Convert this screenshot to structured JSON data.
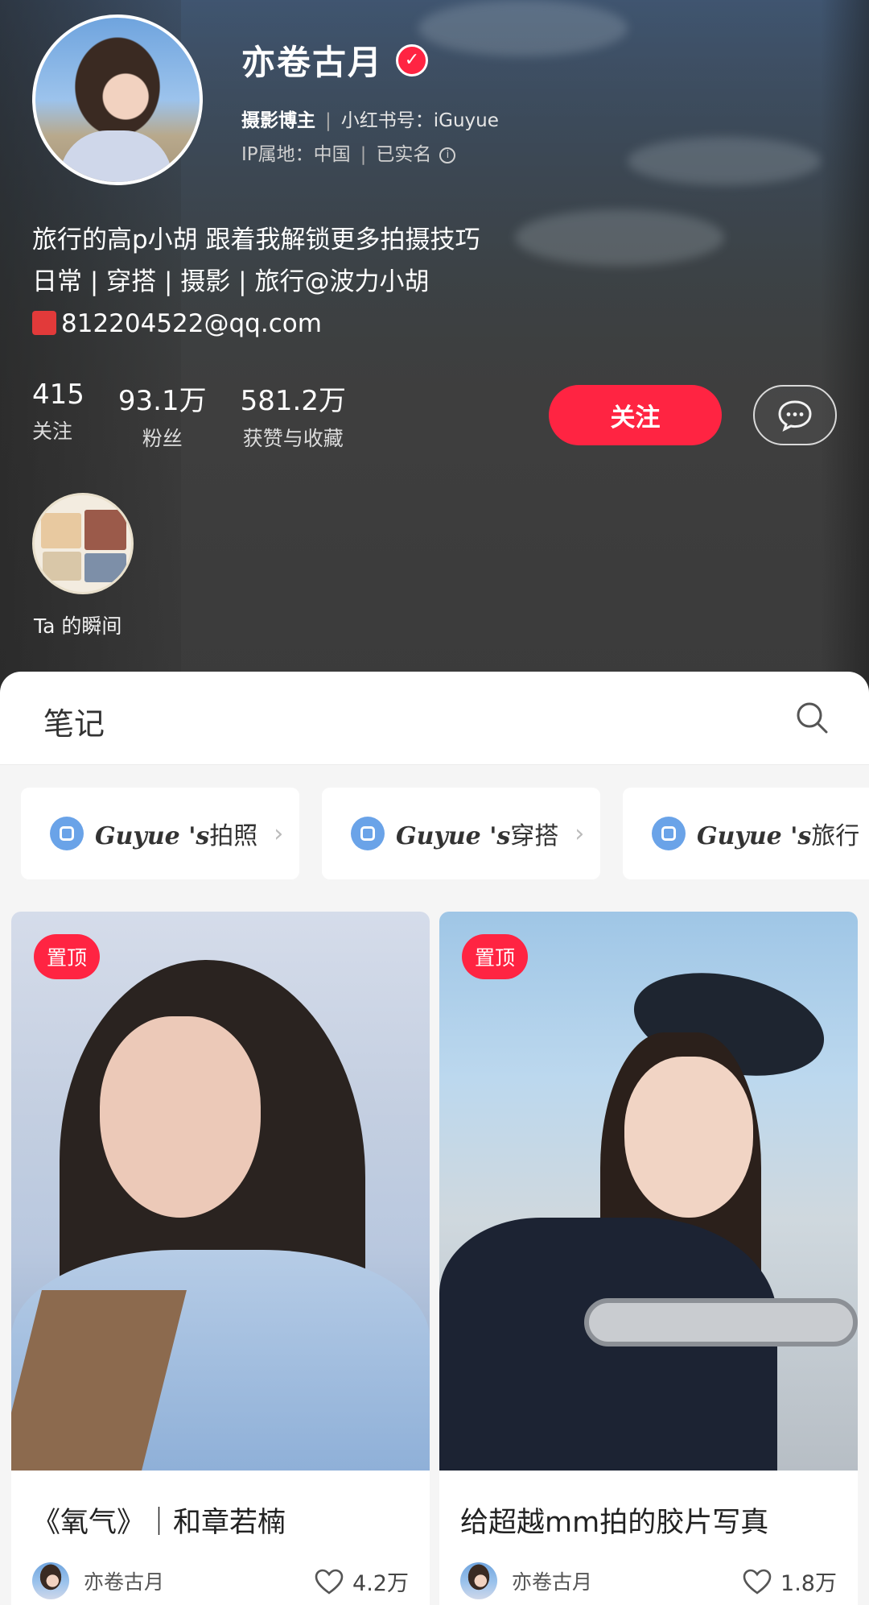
{
  "profile": {
    "name": "亦卷古月",
    "role": "摄影博主",
    "account_label": "小红书号：",
    "account_id": "iGuyue",
    "ip_label": "IP属地：",
    "ip_value": "中国",
    "realname": "已实名",
    "bio_line1": "旅行的高p小胡  跟着我解锁更多拍摄技巧",
    "bio_line2": "日常 | 穿搭 | 摄影 | 旅行@波力小胡",
    "bio_email": "812204522@qq.com",
    "follow_label": "关注",
    "moment_label": "Ta 的瞬间"
  },
  "stats": [
    {
      "value": "415",
      "label": "关注"
    },
    {
      "value": "93.1万",
      "label": "粉丝"
    },
    {
      "value": "581.2万",
      "label": "获赞与收藏"
    }
  ],
  "notes_tab": {
    "title": "笔记"
  },
  "collections": [
    {
      "prefix": "Guyue 's",
      "suffix": "拍照"
    },
    {
      "prefix": "Guyue 's",
      "suffix": "穿搭"
    },
    {
      "prefix": "Guyue 's",
      "suffix": "旅行"
    }
  ],
  "cards": [
    {
      "badge": "置顶",
      "title": "《氧气》｜和章若楠",
      "author": "亦卷古月",
      "likes": "4.2万"
    },
    {
      "badge": "置顶",
      "title": "给超越mm拍的胶片写真",
      "author": "亦卷古月",
      "likes": "1.8万"
    }
  ],
  "colors": {
    "accent": "#ff2442",
    "collection_icon": "#6aa3e8"
  }
}
